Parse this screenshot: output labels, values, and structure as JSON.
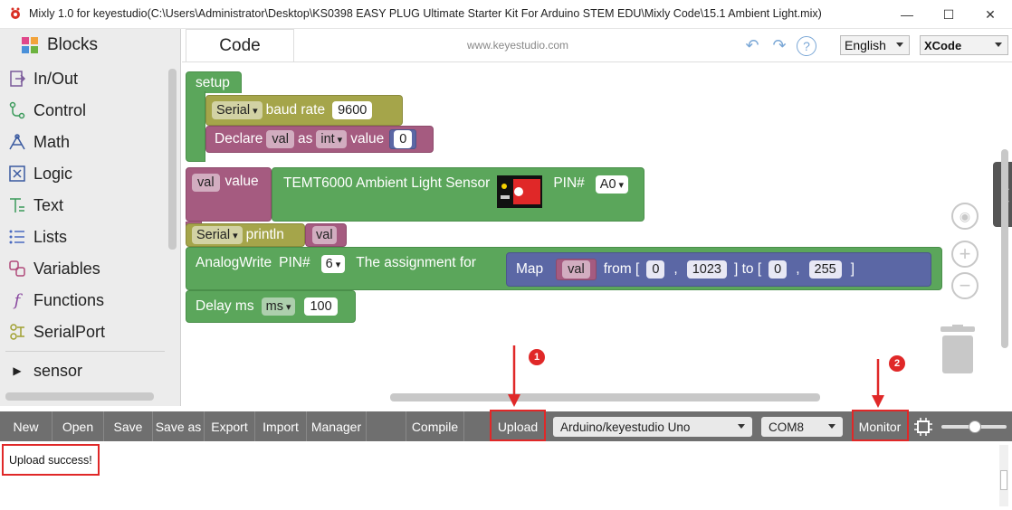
{
  "window": {
    "title": "Mixly 1.0 for keyestudio(C:\\Users\\Administrator\\Desktop\\KS0398 EASY PLUG Ultimate Starter Kit For Arduino STEM EDU\\Mixly Code\\15.1 Ambient Light.mix)",
    "minimize": "—",
    "maximize": "☐",
    "close": "✕"
  },
  "sidebar": {
    "header": "Blocks",
    "items": [
      {
        "label": "In/Out",
        "icon": "in-out-icon"
      },
      {
        "label": "Control",
        "icon": "control-icon"
      },
      {
        "label": "Math",
        "icon": "math-icon"
      },
      {
        "label": "Logic",
        "icon": "logic-icon"
      },
      {
        "label": "Text",
        "icon": "text-icon"
      },
      {
        "label": "Lists",
        "icon": "lists-icon"
      },
      {
        "label": "Variables",
        "icon": "variables-icon"
      },
      {
        "label": "Functions",
        "icon": "functions-icon"
      },
      {
        "label": "SerialPort",
        "icon": "serialport-icon"
      }
    ],
    "group": "sensor"
  },
  "header": {
    "code_tab": "Code",
    "website": "www.keyestudio.com",
    "language": "English",
    "code_mode": "XCode",
    "help": "?"
  },
  "blocks": {
    "setup": "setup",
    "serial1": "Serial",
    "baud_label": "baud rate",
    "baud_value": "9600",
    "declare": "Declare",
    "declare_var": "val",
    "declare_as": "as",
    "declare_type": "int",
    "declare_value_label": "value",
    "declare_value": "0",
    "assign_var": "val",
    "assign_value": "value",
    "sensor_label": "TEMT6000 Ambient Light Sensor",
    "pin_label": "PIN#",
    "sensor_pin": "A0",
    "serial2": "Serial",
    "println": "println",
    "println_var": "val",
    "analogwrite": "AnalogWrite",
    "aw_pin_label": "PIN#",
    "aw_pin": "6",
    "assignment_for": "The assignment for",
    "map": "Map",
    "map_var": "val",
    "from": "from [",
    "from_low": "0",
    "comma1": ",",
    "from_high": "1023",
    "to": "] to [",
    "to_low": "0",
    "comma2": ",",
    "to_high": "255",
    "close_bracket": "]",
    "delay": "Delay ms",
    "delay_unit": "ms",
    "delay_value": "100"
  },
  "toolbar": {
    "new": "New",
    "open": "Open",
    "save": "Save",
    "save_as": "Save as",
    "export": "Export",
    "import": "Import",
    "manager": "Manager",
    "compile": "Compile",
    "upload": "Upload",
    "board": "Arduino/keyestudio Uno",
    "port": "COM8",
    "monitor": "Monitor"
  },
  "console": {
    "message": "Upload success!"
  },
  "annotations": {
    "badge1": "1",
    "badge2": "2",
    "color": "#e02828"
  }
}
